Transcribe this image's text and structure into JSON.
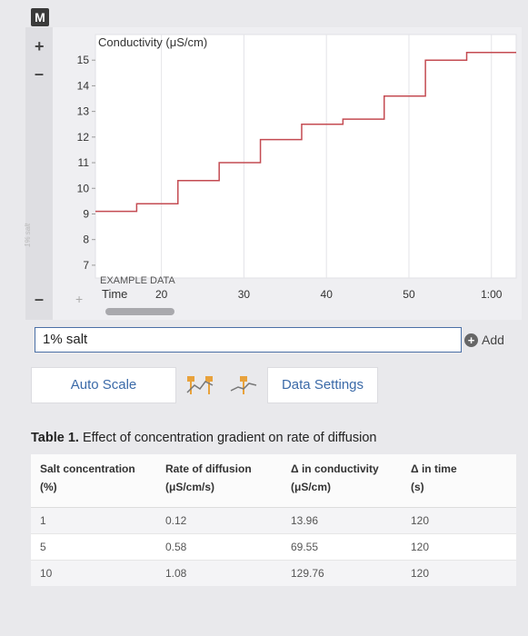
{
  "app": {
    "logo_letter": "M",
    "plus_label": "+",
    "minus_label": "–",
    "vertical_label": "1% salt"
  },
  "chart_data": {
    "type": "line",
    "title": "Conductivity (μS/cm)",
    "xlabel": "Time",
    "ylabel": "Conductivity (μS/cm)",
    "watermark": "EXAMPLE DATA",
    "x_ticks": [
      {
        "value": 20,
        "label": "20"
      },
      {
        "value": 30,
        "label": "30"
      },
      {
        "value": 40,
        "label": "40"
      },
      {
        "value": 50,
        "label": "50"
      },
      {
        "value": 60,
        "label": "1:00"
      }
    ],
    "y_ticks": [
      7,
      8,
      9,
      10,
      11,
      12,
      13,
      14,
      15
    ],
    "xlim": [
      12,
      63
    ],
    "ylim": [
      6.5,
      16
    ],
    "grid": true,
    "series": [
      {
        "color": "#c44b52",
        "x": [
          12,
          17,
          17,
          22,
          22,
          27,
          27,
          32,
          32,
          37,
          37,
          42,
          42,
          47,
          47,
          52,
          52,
          57,
          57,
          63
        ],
        "y": [
          9.1,
          9.1,
          9.4,
          9.4,
          10.3,
          10.3,
          11.0,
          11.0,
          11.9,
          11.9,
          12.5,
          12.5,
          12.7,
          12.7,
          13.6,
          13.6,
          15.0,
          15.0,
          15.3,
          15.3
        ]
      }
    ],
    "add_point_label": "+"
  },
  "salt_field": {
    "value": "1% salt"
  },
  "add_button": {
    "label": "Add"
  },
  "toolbar": {
    "auto_scale": "Auto Scale",
    "data_settings": "Data Settings"
  },
  "table": {
    "title_bold": "Table 1.",
    "title_rest": " Effect of concentration gradient on rate of diffusion",
    "headers": [
      [
        "Salt concentration",
        "(%)"
      ],
      [
        "Rate of diffusion",
        "(μS/cm/s)"
      ],
      [
        "Δ in conductivity",
        "(μS/cm)"
      ],
      [
        "Δ in time",
        "(s)"
      ]
    ],
    "rows": [
      [
        "1",
        "0.12",
        "13.96",
        "120"
      ],
      [
        "5",
        "0.58",
        "69.55",
        "120"
      ],
      [
        "10",
        "1.08",
        "129.76",
        "120"
      ]
    ]
  }
}
